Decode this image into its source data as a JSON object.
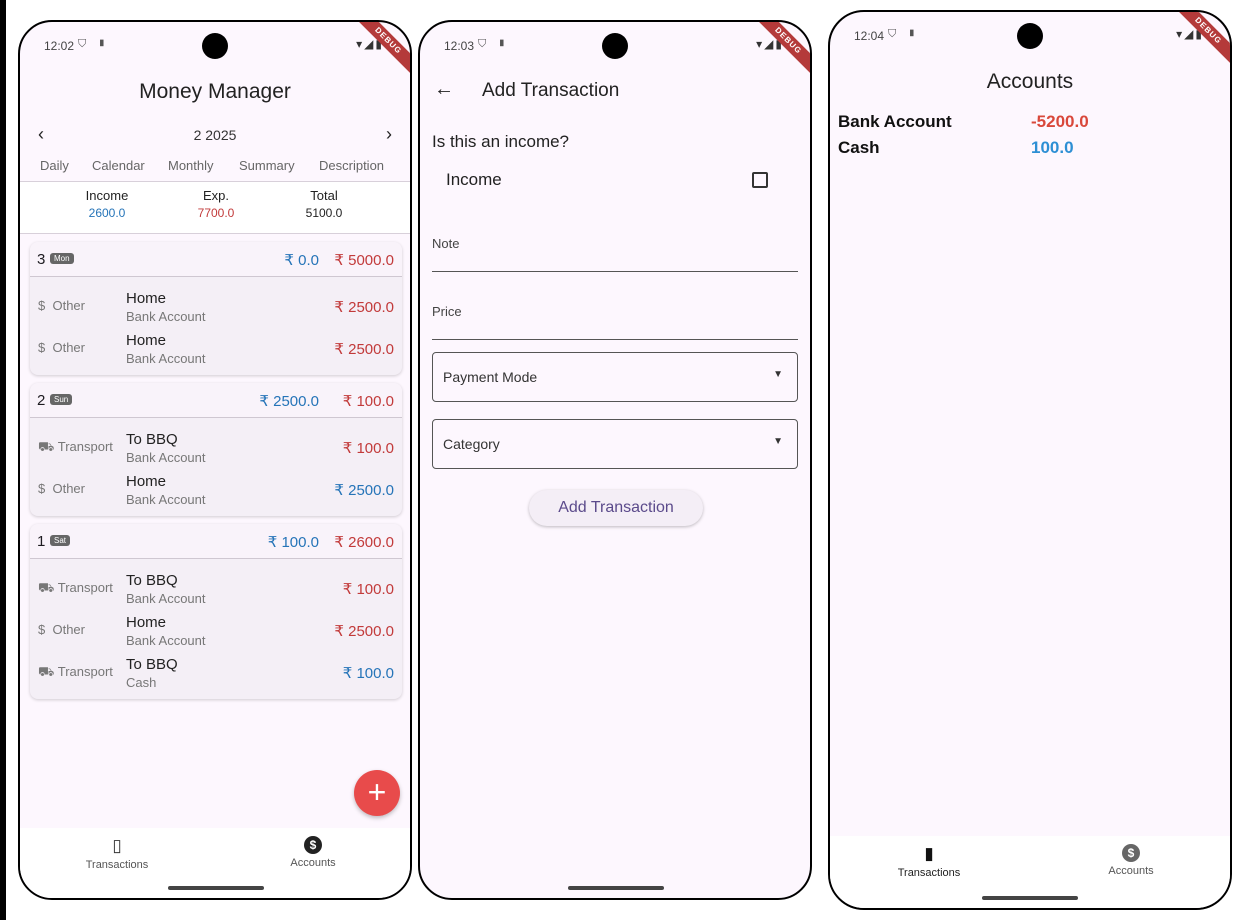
{
  "screens": [
    {
      "status": {
        "time": "12:02",
        "debug": "DEBUG"
      },
      "title": "Money Manager",
      "month": "2 2025",
      "tabs": [
        "Daily",
        "Calendar",
        "Monthly",
        "Summary",
        "Description"
      ],
      "totals": {
        "income_label": "Income",
        "income_value": "2600.0",
        "exp_label": "Exp.",
        "exp_value": "7700.0",
        "total_label": "Total",
        "total_value": "5100.0"
      },
      "days": [
        {
          "day": "3",
          "weekday": "Mon",
          "income": "₹ 0.0",
          "expense": "₹ 5000.0",
          "rows": [
            {
              "icon": "$",
              "category": "Other",
              "note": "Home",
              "account": "Bank Account",
              "amount": "₹ 2500.0",
              "type": "expense"
            },
            {
              "icon": "$",
              "category": "Other",
              "note": "Home",
              "account": "Bank Account",
              "amount": "₹ 2500.0",
              "type": "expense"
            }
          ]
        },
        {
          "day": "2",
          "weekday": "Sun",
          "income": "₹ 2500.0",
          "expense": "₹ 100.0",
          "rows": [
            {
              "icon": "car",
              "category": "Transport",
              "note": "To BBQ",
              "account": "Bank Account",
              "amount": "₹ 100.0",
              "type": "expense"
            },
            {
              "icon": "$",
              "category": "Other",
              "note": "Home",
              "account": "Bank Account",
              "amount": "₹ 2500.0",
              "type": "income"
            }
          ]
        },
        {
          "day": "1",
          "weekday": "Sat",
          "income": "₹ 100.0",
          "expense": "₹ 2600.0",
          "rows": [
            {
              "icon": "car",
              "category": "Transport",
              "note": "To BBQ",
              "account": "Bank Account",
              "amount": "₹ 100.0",
              "type": "expense"
            },
            {
              "icon": "$",
              "category": "Other",
              "note": "Home",
              "account": "Bank Account",
              "amount": "₹ 2500.0",
              "type": "expense"
            },
            {
              "icon": "car",
              "category": "Transport",
              "note": "To BBQ",
              "account": "Cash",
              "amount": "₹ 100.0",
              "type": "income"
            }
          ]
        }
      ],
      "nav": {
        "transactions": "Transactions",
        "accounts": "Accounts"
      }
    },
    {
      "status": {
        "time": "12:03",
        "debug": "DEBUG"
      },
      "title": "Add Transaction",
      "question": "Is this an income?",
      "checkbox_label": "Income",
      "checkbox_checked": false,
      "note_label": "Note",
      "price_label": "Price",
      "payment_mode_label": "Payment Mode",
      "category_label": "Category",
      "submit_label": "Add Transaction"
    },
    {
      "status": {
        "time": "12:04",
        "debug": "DEBUG"
      },
      "title": "Accounts",
      "accounts": [
        {
          "name": "Bank Account",
          "balance": "-5200.0"
        },
        {
          "name": "Cash",
          "balance": "100.0"
        }
      ],
      "nav": {
        "transactions": "Transactions",
        "accounts": "Accounts"
      }
    }
  ],
  "colors": {
    "income": "#2574b8",
    "expense": "#c23a3a",
    "fab": "#e84b4b",
    "background": "#fdf7fe",
    "accent": "#5b4a8b"
  }
}
